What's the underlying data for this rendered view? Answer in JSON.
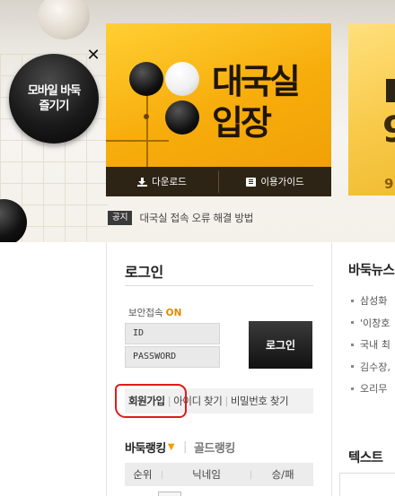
{
  "banner": {
    "mobile_badge": {
      "line1": "모바일 바둑",
      "line2": "즐기기"
    },
    "close_icon": "close-icon",
    "enter_room": {
      "title_line1": "대국실",
      "title_line2": "입장",
      "download_label": "다운로드",
      "guide_label": "이용가이드"
    },
    "side_card": {
      "big_number": "9",
      "small_number": "9"
    },
    "notice": {
      "tag": "공지",
      "text": "대국실 접속 오류 해결 방법"
    }
  },
  "login": {
    "title": "로그인",
    "secure_label": "보안접속",
    "secure_status": "ON",
    "id_placeholder": "ID",
    "password_placeholder": "PASSWORD",
    "login_button": "로그인",
    "links": {
      "signup": "회원가입",
      "find_id": "아이디 찾기",
      "find_pw": "비밀번호 찾기"
    }
  },
  "ranking": {
    "tab_baduk": "바둑랭킹",
    "tab_gold": "골드랭킹",
    "columns": [
      "순위",
      "닉네임",
      "승/패"
    ]
  },
  "news": {
    "title": "바둑뉴스",
    "items": [
      "삼성화",
      "'이창호",
      "국내 최",
      "김수장,",
      "오리무"
    ]
  },
  "text_section": {
    "title": "텍스트"
  },
  "colors": {
    "accent": "#f0a000",
    "annotation_red": "#e01a1a",
    "card_yellow": "#f7ad0c"
  }
}
